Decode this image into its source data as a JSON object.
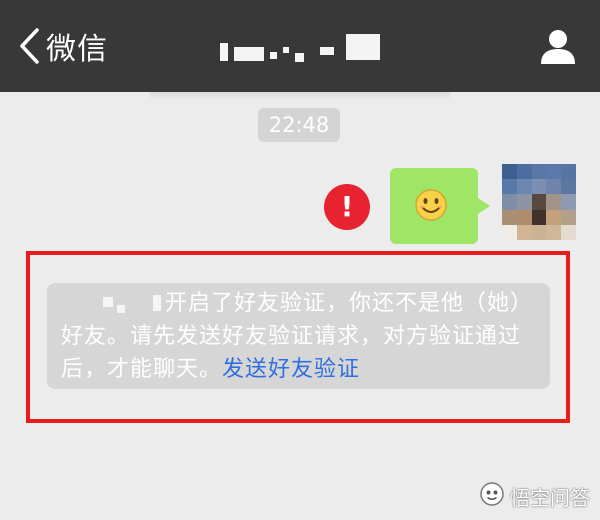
{
  "navbar": {
    "back_label": "微信"
  },
  "chat": {
    "timestamp": "22:48",
    "message": {
      "content_icon": "smiley-emoji",
      "status_icon": "send-failed-exclamation",
      "status_color": "#e6232f",
      "bubble_color": "#9fe566"
    },
    "notice": {
      "text": "开启了好友验证，你还不是他（她）好友。请先发送好友验证请求，对方验证通过后，才能聊天。",
      "link": "发送好友验证"
    }
  },
  "annotation": {
    "highlight_color": "#ea1b1b"
  },
  "watermark": {
    "text": "悟空问答"
  }
}
